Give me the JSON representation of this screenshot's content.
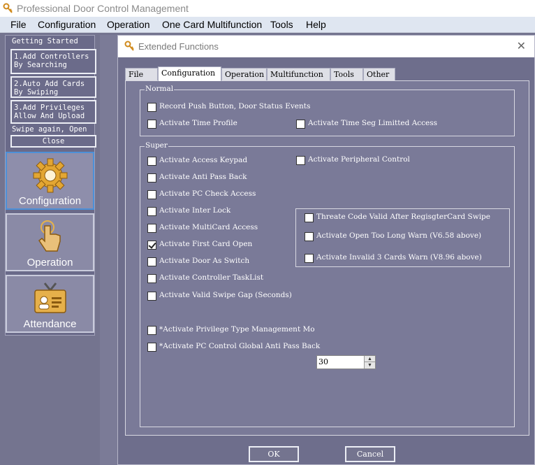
{
  "app": {
    "title": "Professional Door Control Management"
  },
  "menu": [
    "File",
    "Configuration",
    "Operation",
    "One Card Multifunction",
    "Tools",
    "Help"
  ],
  "sidebar": {
    "getting_started": "Getting Started",
    "steps": [
      "1.Add Controllers\nBy Searching",
      "2.Auto Add Cards\nBy Swiping",
      "3.Add Privileges\nAllow And Upload"
    ],
    "swipe_text": "Swipe again, Open",
    "close_label": "Close",
    "big_buttons": [
      {
        "label": "Configuration",
        "icon": "gear-icon",
        "selected": true
      },
      {
        "label": "Operation",
        "icon": "hand-pointer-icon",
        "selected": false
      },
      {
        "label": "Attendance",
        "icon": "id-card-icon",
        "selected": false
      }
    ]
  },
  "dialog": {
    "title": "Extended Functions",
    "tabs": [
      "File",
      "Configuration",
      "Operation",
      "Multifunction",
      "Tools",
      "Other"
    ],
    "active_tab": "Configuration",
    "normal_group": {
      "title": "Normal",
      "items": [
        {
          "label": "Record Push Button, Door Status Events",
          "checked": false
        },
        {
          "label": "Activate Time Profile",
          "checked": false
        },
        {
          "label": "Activate Time Seg Limitted Access",
          "checked": false
        }
      ]
    },
    "super_group": {
      "title": "Super",
      "left_items": [
        {
          "label": "Activate Access Keypad",
          "checked": false
        },
        {
          "label": "Activate Anti Pass Back",
          "checked": false
        },
        {
          "label": "Activate PC Check Access",
          "checked": false
        },
        {
          "label": "Activate Inter Lock",
          "checked": false
        },
        {
          "label": "Activate MultiCard Access",
          "checked": false
        },
        {
          "label": "Activate First Card Open",
          "checked": true
        },
        {
          "label": "Activate Door As Switch",
          "checked": false
        },
        {
          "label": "Activate Controller TaskList",
          "checked": false
        },
        {
          "label": "Activate Valid Swipe Gap (Seconds)",
          "checked": false
        }
      ],
      "peripheral": {
        "label": "Activate Peripheral Control",
        "checked": false
      },
      "peripheral_items": [
        {
          "label": "Threate Code Valid After RegisgterCard Swipe",
          "checked": false
        },
        {
          "label": "Activate Open Too Long Warn (V6.58 above)",
          "checked": false
        },
        {
          "label": "Activate Invalid 3 Cards  Warn (V8.96 above)",
          "checked": false
        }
      ],
      "privilege_type": {
        "label": "*Activate Privilege Type Management Mo",
        "checked": false,
        "value": "30"
      },
      "global_antipass": {
        "label": "*Activate PC Control Global Anti Pass Back",
        "checked": false
      }
    },
    "ok_label": "OK",
    "cancel_label": "Cancel"
  }
}
